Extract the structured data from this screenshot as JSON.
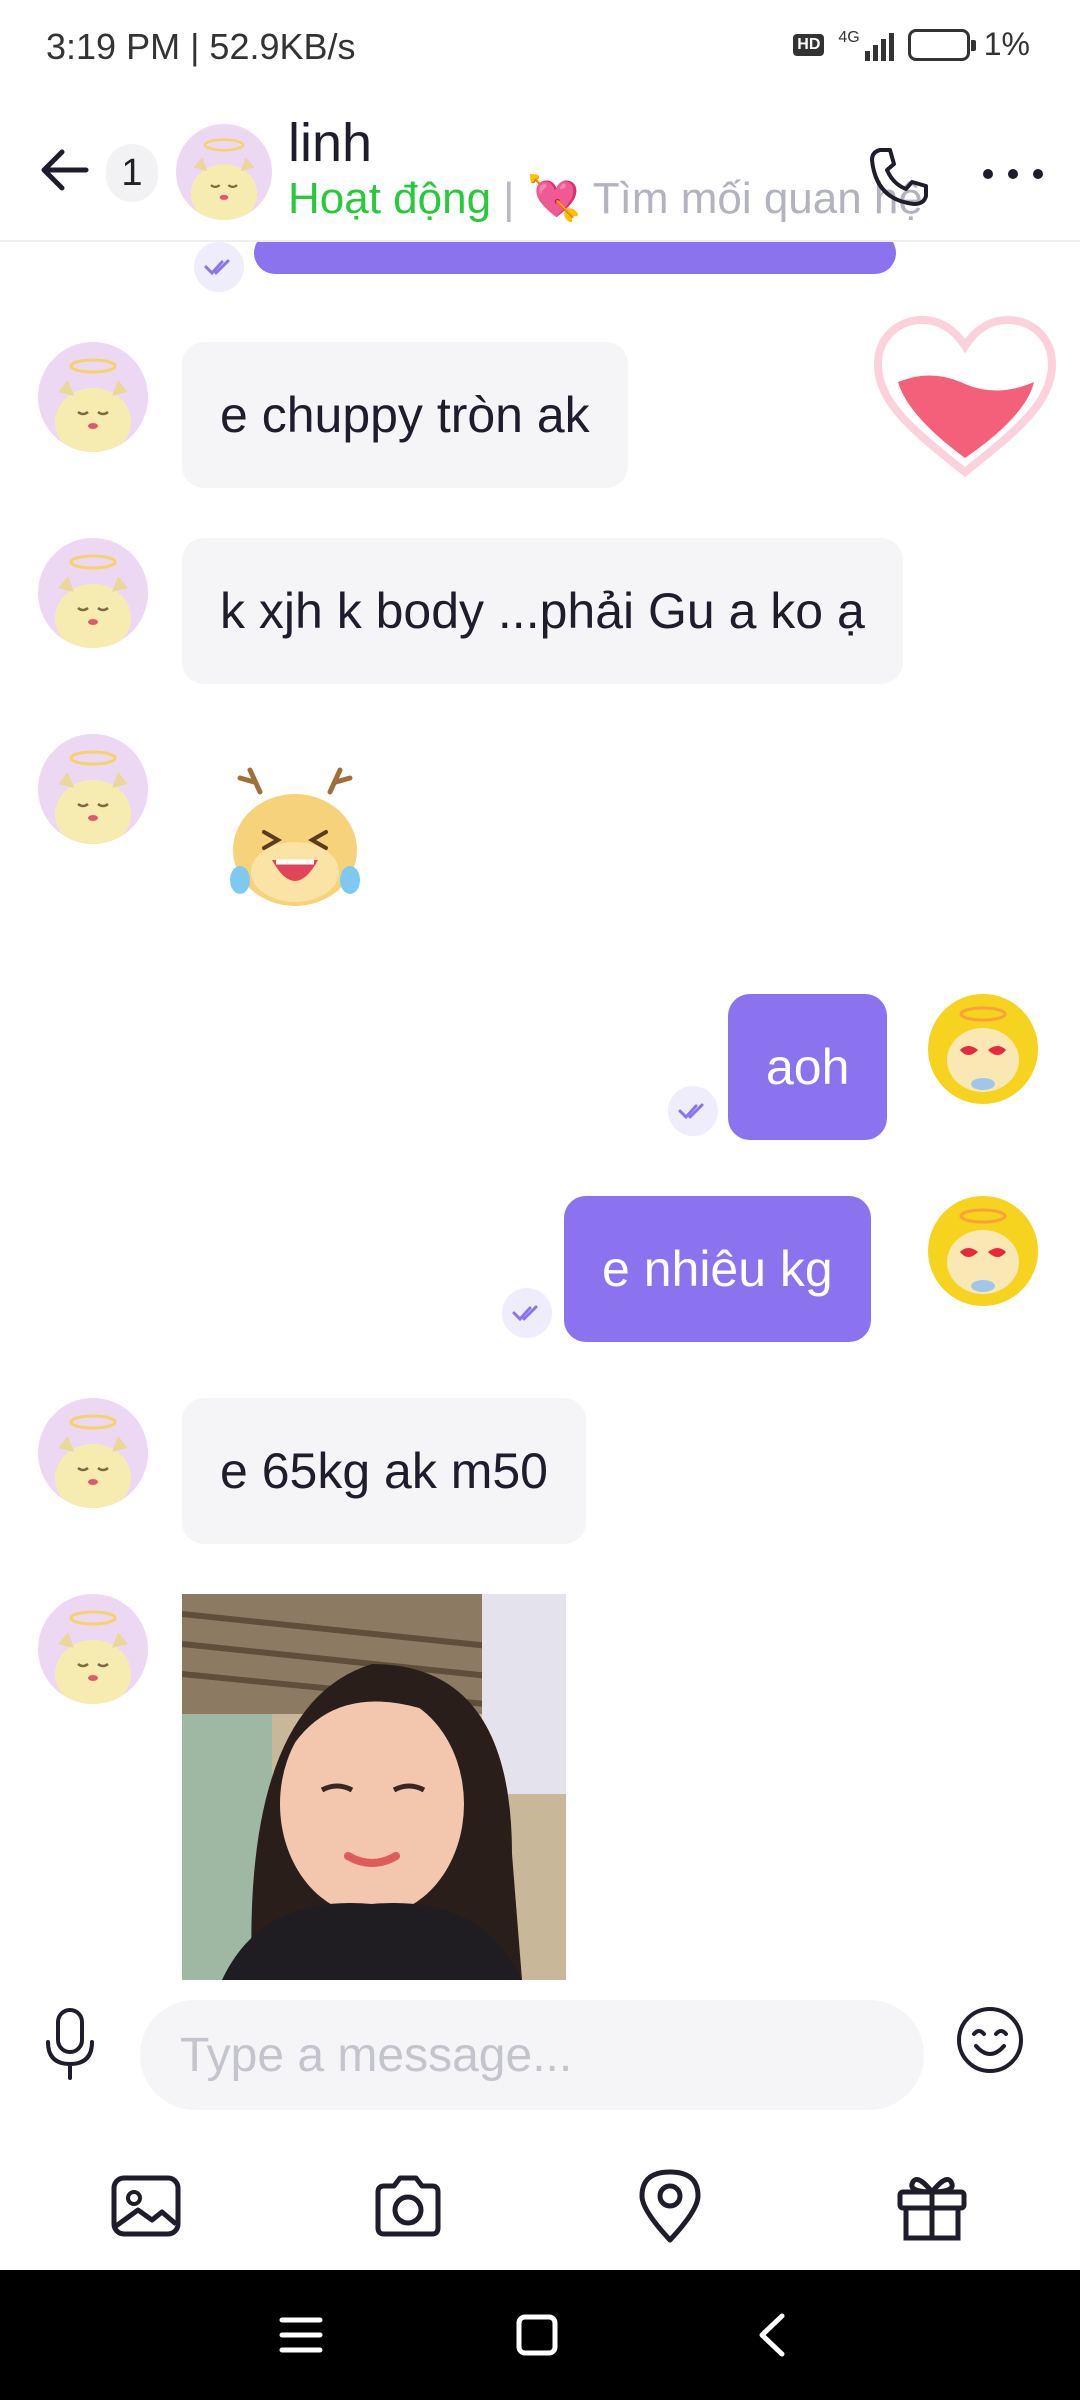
{
  "status_bar": {
    "time_speed": "3:19 PM | 52.9KB/s",
    "hd": "HD",
    "network": "4G",
    "battery": "1%"
  },
  "header": {
    "unread_count": "1",
    "contact_name": "linh",
    "status_online": "Hoạt động",
    "status_separator": "|",
    "status_tagline": "💘 Tìm mối quan hệ"
  },
  "messages": [
    {
      "sender": "them",
      "type": "text",
      "text": "e chuppy tròn ak"
    },
    {
      "sender": "them",
      "type": "text",
      "text": "k xjh k body ...phải Gu a ko ạ"
    },
    {
      "sender": "them",
      "type": "sticker",
      "emoji": "😆"
    },
    {
      "sender": "me",
      "type": "text",
      "text": "aoh",
      "read": true
    },
    {
      "sender": "me",
      "type": "text",
      "text": "e nhiêu kg",
      "read": true
    },
    {
      "sender": "them",
      "type": "text",
      "text": "e 65kg ak m50"
    },
    {
      "sender": "them",
      "type": "image"
    }
  ],
  "composer": {
    "placeholder": "Type a message..."
  },
  "toolbar": [
    "gallery-icon",
    "camera-icon",
    "location-icon",
    "gift-icon"
  ],
  "colors": {
    "accent": "#8b72ee",
    "online": "#28c93c",
    "incoming_bubble": "#f5f5f8"
  }
}
